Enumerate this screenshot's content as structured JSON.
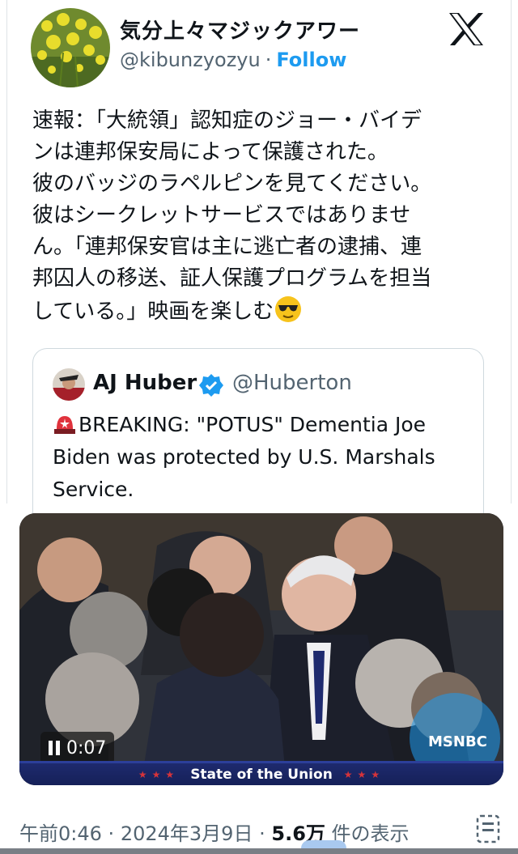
{
  "author": {
    "display_name": "気分上々マジックアワー",
    "handle": "@kibunzyozyu",
    "separator": "·",
    "follow_label": "Follow"
  },
  "tweet": {
    "lines": [
      "速報：「大統領」認知症のジョー・バイデ",
      "ンは連邦保安局によって保護された。",
      "彼のバッジのラペルピンを見てください。",
      "彼はシークレットサービスではありませ",
      "ん。「連邦保安官は主に逃亡者の逮捕、連",
      "邦囚人の移送、証人保護プログラムを担当",
      "している。」映画を楽しむ"
    ]
  },
  "quoted": {
    "name": "AJ Huber",
    "handle": "@Huberton",
    "lines": [
      "BREAKING: \"POTUS\" Dementia Joe",
      "Biden was protected by U.S. Marshals",
      "Service."
    ]
  },
  "video": {
    "time": "0:07",
    "banner": "State of the Union",
    "network": "MSNBC"
  },
  "meta": {
    "time": "午前0:46",
    "separator": "·",
    "date": "2024年3月9日",
    "views_count": "5.6万",
    "views_label": "件の表示"
  },
  "icons": {
    "x_logo": "x-logo-icon",
    "verified": "verified-badge-icon",
    "siren": "siren-icon",
    "emoji": "sunglasses-emoji-icon",
    "analytics": "analytics-icon"
  },
  "colors": {
    "accent": "#1d9bf0",
    "secondary_text": "#536471",
    "text": "#0f1419"
  }
}
